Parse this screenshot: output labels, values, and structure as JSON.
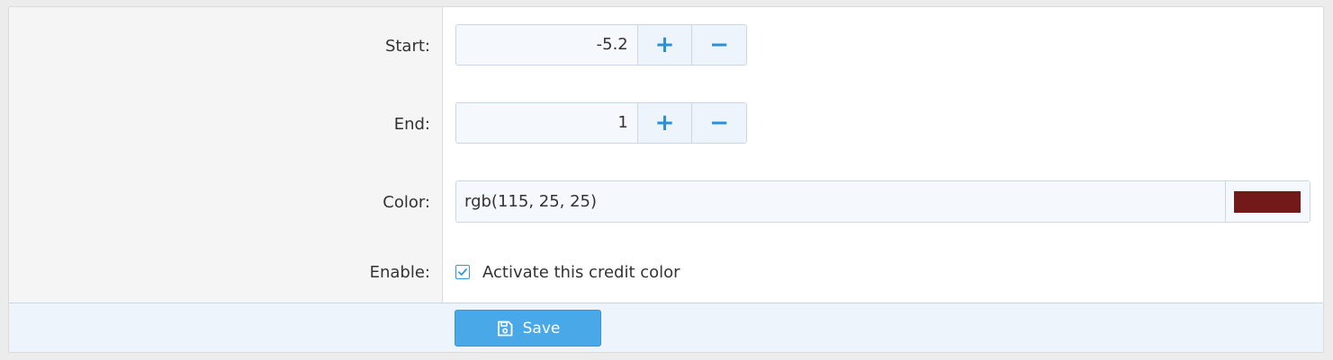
{
  "form": {
    "start": {
      "label": "Start:",
      "value": "-5.2"
    },
    "end": {
      "label": "End:",
      "value": "1"
    },
    "color": {
      "label": "Color:",
      "value": "rgb(115, 25, 25)",
      "swatch": "#731919"
    },
    "enable": {
      "label": "Enable:",
      "checkbox_label": "Activate this credit color",
      "checked": true
    }
  },
  "stepper": {
    "plus_glyph": "+",
    "minus_glyph": "−"
  },
  "footer": {
    "save_label": "Save"
  },
  "colors": {
    "accent": "#48a8e8",
    "field_bg": "#f5f9fd",
    "label_bg": "#f5f5f5",
    "footer_bg": "#eef4fb"
  }
}
